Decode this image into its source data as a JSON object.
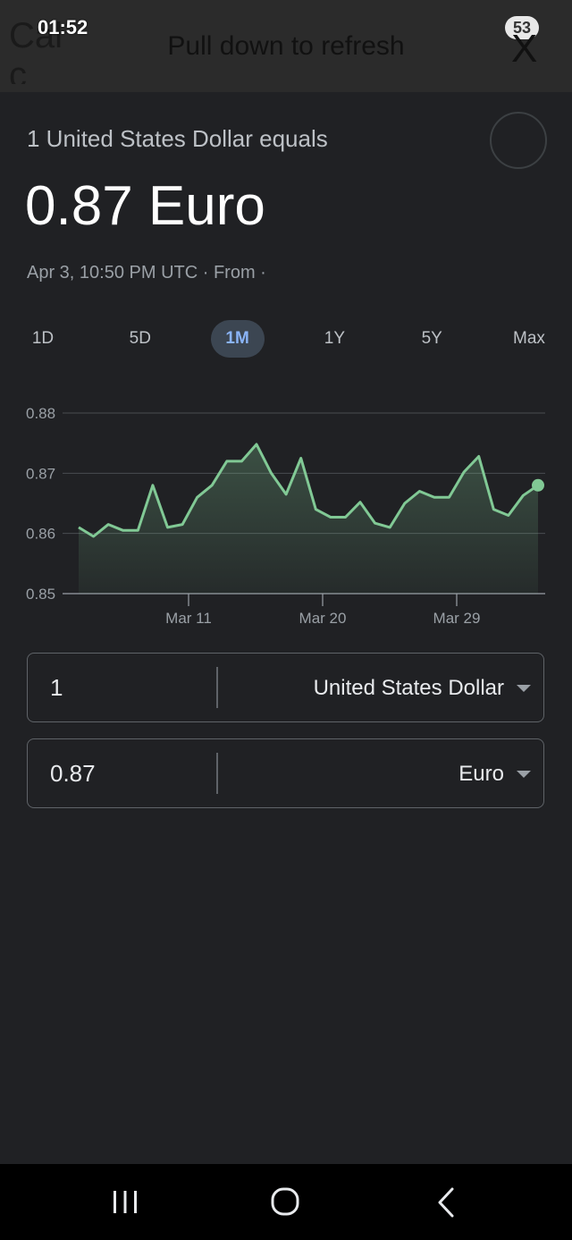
{
  "status": {
    "app_title": "Cal c",
    "clock": "01:52",
    "refresh_hint": "Pull down to refresh",
    "badge": "53",
    "close_label": "X"
  },
  "header": {
    "equals_label": "1 United States Dollar equals",
    "value": "0.87 Euro",
    "timestamp": "Apr 3, 10:50 PM UTC · From ·"
  },
  "ranges": [
    "1D",
    "5D",
    "1M",
    "1Y",
    "5Y",
    "Max"
  ],
  "active_range": "1M",
  "chart_data": {
    "type": "area",
    "xlabel": "",
    "ylabel": "",
    "ylim": [
      0.85,
      0.88
    ],
    "yticks": [
      "0.88",
      "0.87",
      "0.86",
      "0.85"
    ],
    "xticks": [
      "Mar 11",
      "Mar 20",
      "Mar 29"
    ],
    "grid": true,
    "line_color": "#81c995",
    "series": [
      {
        "values": [
          0.861,
          0.8595,
          0.8615,
          0.8605,
          0.8605,
          0.868,
          0.861,
          0.8615,
          0.866,
          0.868,
          0.872,
          0.872,
          0.8748,
          0.87,
          0.8665,
          0.8725,
          0.864,
          0.8627,
          0.8627,
          0.8652,
          0.8617,
          0.861,
          0.865,
          0.867,
          0.866,
          0.866,
          0.8702,
          0.8728,
          0.864,
          0.863,
          0.8663,
          0.868
        ]
      }
    ]
  },
  "converter": {
    "from": {
      "amount": "1",
      "currency": "United States Dollar"
    },
    "to": {
      "amount": "0.87",
      "currency": "Euro"
    }
  },
  "navbar": {
    "items": [
      "recent-apps",
      "home",
      "back"
    ]
  }
}
